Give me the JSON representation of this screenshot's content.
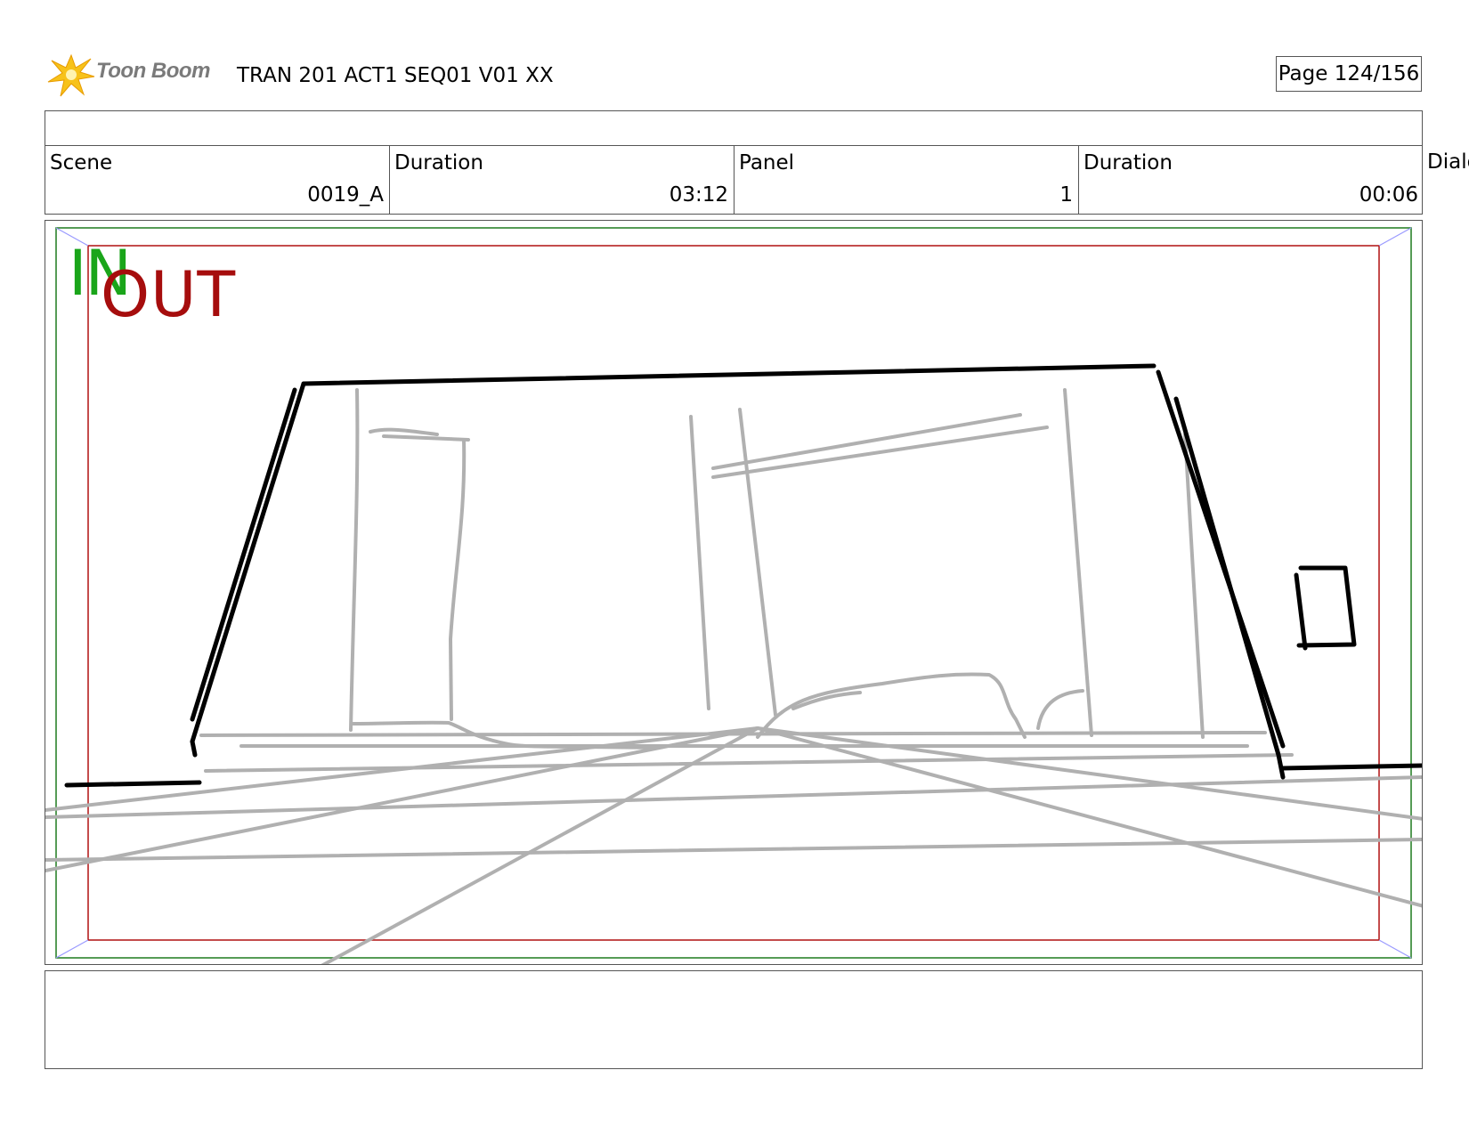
{
  "header": {
    "logo_text": "Toon Boom",
    "title": "TRAN 201 ACT1 SEQ01 V01 XX",
    "page": "Page 124/156"
  },
  "info": {
    "scene_label": "Scene",
    "scene_value": "0019_A",
    "duration_label": "Duration",
    "duration_value": "03:12",
    "panel_label": "Panel",
    "panel_value": "1",
    "panel_duration_label": "Duration",
    "panel_duration_value": "00:06",
    "dialog_label": "Dialog"
  },
  "panel": {
    "in_label": "IN",
    "out_label": "OUT"
  },
  "colors": {
    "in_frame": "#1e7a1e",
    "out_frame": "#b01010",
    "sketch_dark": "#000000",
    "sketch_light": "#b0b0b0"
  }
}
